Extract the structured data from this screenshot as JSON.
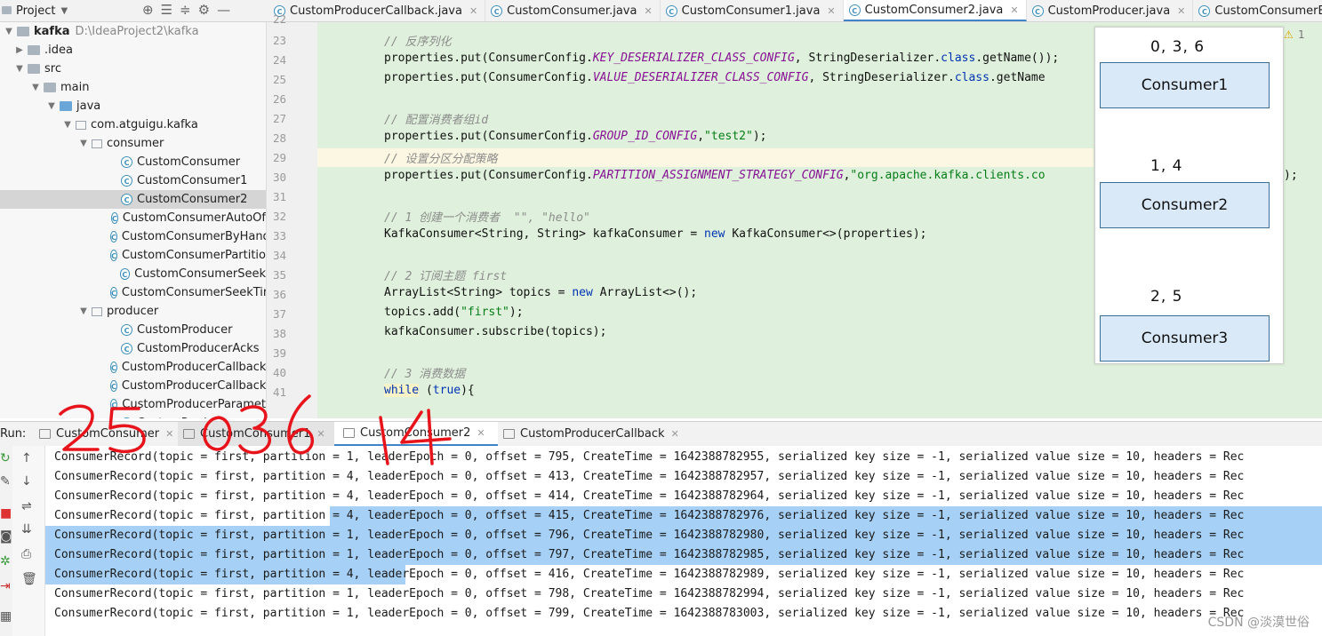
{
  "project_header": {
    "label": "Project"
  },
  "editor_tabs": [
    {
      "label": "CustomProducerCallback.java",
      "active": false
    },
    {
      "label": "CustomConsumer.java",
      "active": false
    },
    {
      "label": "CustomConsumer1.java",
      "active": false
    },
    {
      "label": "CustomConsumer2.java",
      "active": true
    },
    {
      "label": "CustomProducer.java",
      "active": false
    },
    {
      "label": "CustomConsumerByHandSy",
      "active": false
    }
  ],
  "tree": {
    "root": {
      "label": "kafka",
      "path": "D:\\IdeaProject2\\kafka"
    },
    "items": [
      {
        "label": ".idea"
      },
      {
        "label": "src"
      },
      {
        "label": "main"
      },
      {
        "label": "java"
      },
      {
        "label": "com.atguigu.kafka"
      },
      {
        "label": "consumer"
      },
      {
        "label": "CustomConsumer"
      },
      {
        "label": "CustomConsumer1"
      },
      {
        "label": "CustomConsumer2"
      },
      {
        "label": "CustomConsumerAutoOf"
      },
      {
        "label": "CustomConsumerByHand"
      },
      {
        "label": "CustomConsumerPartitio"
      },
      {
        "label": "CustomConsumerSeek"
      },
      {
        "label": "CustomConsumerSeekTir"
      },
      {
        "label": "producer"
      },
      {
        "label": "CustomProducer"
      },
      {
        "label": "CustomProducerAcks"
      },
      {
        "label": "CustomProducerCallback"
      },
      {
        "label": "CustomProducerCallback"
      },
      {
        "label": "CustomProducerParamet"
      },
      {
        "label": "CustomProducer"
      }
    ]
  },
  "editor": {
    "line_numbers": [
      "22",
      "23",
      "24",
      "25",
      "26",
      "27",
      "28",
      "29",
      "30",
      "31",
      "32",
      "33",
      "34",
      "35",
      "36",
      "37",
      "38",
      "39",
      "40",
      "41"
    ],
    "warning_badge": "1",
    "code": {
      "l23": "// 反序列化",
      "l24a": "properties.put(ConsumerConfig.",
      "l24b": "KEY_DESERIALIZER_CLASS_CONFIG",
      "l24c": ", StringDeserializer.",
      "l24d": "class",
      "l24e": ".getName());",
      "l25a": "properties.put(ConsumerConfig.",
      "l25b": "VALUE_DESERIALIZER_CLASS_CONFIG",
      "l25c": ", StringDeserializer.",
      "l25d": "class",
      "l25e": ".getName",
      "l27": "// 配置消费者组id",
      "l28a": "properties.put(ConsumerConfig.",
      "l28b": "GROUP_ID_CONFIG",
      "l28c": ",",
      "l28d": "\"test2\"",
      "l28e": ");",
      "l29": "// 设置分区分配策略",
      "l30a": "properties.put(ConsumerConfig.",
      "l30b": "PARTITION_ASSIGNMENT_STRATEGY_CONFIG",
      "l30c": ",",
      "l30d": "\"org.apache.kafka.clients.co",
      "l30tail": ");",
      "l32a": "// 1 创建一个消费者  \"\", \"hello\"",
      "l33a": "KafkaConsumer<String, String> kafkaConsumer = ",
      "l33b": "new",
      "l33c": " KafkaConsumer<>(properties);",
      "l35": "// 2 订阅主题 first",
      "l36a": "ArrayList<String> topics = ",
      "l36b": "new",
      "l36c": " ArrayList<>();",
      "l37a": "topics.add(",
      "l37b": "\"first\"",
      "l37c": ");",
      "l38": "kafkaConsumer.subscribe(topics);",
      "l40": "// 3 消费数据",
      "l41a": "while",
      "l41b": " (",
      "l41c": "true",
      "l41d": "){"
    }
  },
  "diagram": {
    "groups": [
      {
        "partitions": "0, 3, 6",
        "consumer": "Consumer1"
      },
      {
        "partitions": "1, 4",
        "consumer": "Consumer2"
      },
      {
        "partitions": "2, 5",
        "consumer": "Consumer3"
      }
    ]
  },
  "run_panel": {
    "label": "Run:",
    "tabs": [
      {
        "label": "CustomConsumer",
        "active": false
      },
      {
        "label": "CustomConsumer1",
        "active": false
      },
      {
        "label": "CustomConsumer2",
        "active": true
      },
      {
        "label": "CustomProducerCallback",
        "active": false
      }
    ],
    "handwritten_annotations": [
      "25",
      "036",
      "14"
    ],
    "console_lines": [
      "ConsumerRecord(topic = first, partition = 1, leaderEpoch = 0, offset = 795, CreateTime = 1642388782955, serialized key size = -1, serialized value size = 10, headers = Rec",
      "ConsumerRecord(topic = first, partition = 4, leaderEpoch = 0, offset = 413, CreateTime = 1642388782957, serialized key size = -1, serialized value size = 10, headers = Rec",
      "ConsumerRecord(topic = first, partition = 4, leaderEpoch = 0, offset = 414, CreateTime = 1642388782964, serialized key size = -1, serialized value size = 10, headers = Rec",
      "ConsumerRecord(topic = first, partition = 4, leaderEpoch = 0, offset = 415, CreateTime = 1642388782976, serialized key size = -1, serialized value size = 10, headers = Rec",
      "ConsumerRecord(topic = first, partition = 1, leaderEpoch = 0, offset = 796, CreateTime = 1642388782980, serialized key size = -1, serialized value size = 10, headers = Rec",
      "ConsumerRecord(topic = first, partition = 1, leaderEpoch = 0, offset = 797, CreateTime = 1642388782985, serialized key size = -1, serialized value size = 10, headers = Rec",
      "ConsumerRecord(topic = first, partition = 4, leaderEpoch = 0, offset = 416, CreateTime = 1642388782989, serialized key size = -1, serialized value size = 10, headers = Rec",
      "ConsumerRecord(topic = first, partition = 1, leaderEpoch = 0, offset = 798, CreateTime = 1642388782994, serialized key size = -1, serialized value size = 10, headers = Rec",
      "ConsumerRecord(topic = first, partition = 1, leaderEpoch = 0, offset = 799, CreateTime = 1642388783003, serialized key size = -1, serialized value size = 10, headers = Rec"
    ]
  },
  "watermark": "CSDN @淡漠世俗",
  "colors": {
    "editor_bg": "#dff1dc",
    "selection": "#a6d0f5",
    "consumer_box": "#d9e9f7",
    "ink": "#e8141c"
  }
}
